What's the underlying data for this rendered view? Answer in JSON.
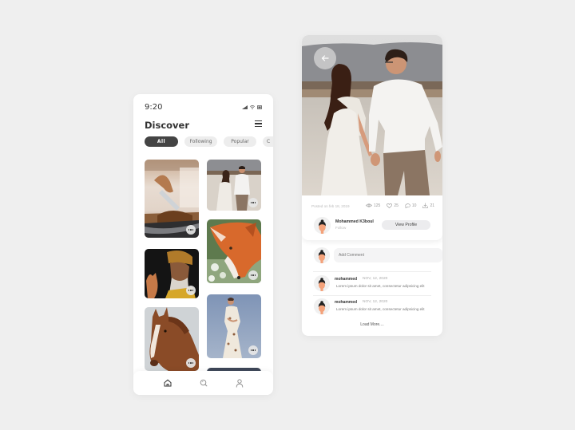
{
  "discover_screen": {
    "status_bar": {
      "time": "9:20",
      "icons": [
        "signal-icon",
        "wifi-icon",
        "battery-icon"
      ]
    },
    "title": "Discover",
    "menu_icon": "hamburger-menu-icon",
    "filters": [
      {
        "label": "All",
        "active": true
      },
      {
        "label": "Following",
        "active": false
      },
      {
        "label": "Popular",
        "active": false
      },
      {
        "label": "C",
        "active": false
      }
    ],
    "photos": [
      {
        "subject": "coffee-beans-scoop",
        "column": "left",
        "more_icon": "more-dots-icon"
      },
      {
        "subject": "couple-walking-beach",
        "column": "right",
        "more_icon": "more-dots-icon"
      },
      {
        "subject": "fox-in-grass",
        "column": "right",
        "more_icon": "more-dots-icon"
      },
      {
        "subject": "old-man-portrait",
        "column": "left",
        "more_icon": "more-dots-icon"
      },
      {
        "subject": "horse-portrait",
        "column": "left",
        "more_icon": "more-dots-icon"
      },
      {
        "subject": "woman-floral-dress",
        "column": "right",
        "more_icon": "more-dots-icon"
      }
    ],
    "bottom_nav": [
      {
        "name": "home",
        "icon": "home-icon",
        "active": true
      },
      {
        "name": "search",
        "icon": "search-icon",
        "active": false
      },
      {
        "name": "profile",
        "icon": "user-icon",
        "active": false
      }
    ]
  },
  "post_screen": {
    "hero_subject": "couple-walking-beach",
    "back_icon": "arrow-left-icon",
    "posted_on": "Posted on feb 18, 2019",
    "stats": {
      "views": "125",
      "likes": "25",
      "comments": "10",
      "downloads": "21"
    },
    "author": {
      "name": "Mohammed K3boul",
      "follow_label": "Follow",
      "view_profile_label": "View Profile"
    },
    "add_comment_placeholder": "Add Comment",
    "comments": [
      {
        "user": "mohammed",
        "date": "NOV, 12, 2020",
        "text": "Lorem ipsum dolor sit amet, consectetur adipsicing elit"
      },
      {
        "user": "mohammed",
        "date": "NOV, 12, 2020",
        "text": "Lorem ipsum dolor sit amet, consectetur adipsicing elit"
      }
    ],
    "load_more_label": "Load More...."
  }
}
